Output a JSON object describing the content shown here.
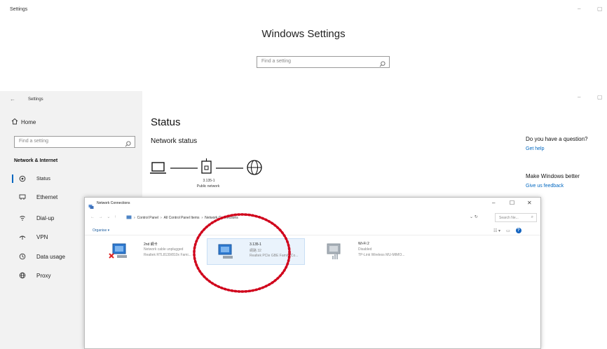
{
  "top_window": {
    "title": "Settings",
    "heading": "Windows Settings",
    "search_placeholder": "Find a setting"
  },
  "settings_window": {
    "title": "Settings",
    "home_label": "Home",
    "search_placeholder": "Find a setting",
    "section_label": "Network & Internet",
    "nav_items": [
      {
        "label": "Status",
        "icon": "status-icon",
        "active": true
      },
      {
        "label": "Ethernet",
        "icon": "ethernet-icon",
        "active": false
      },
      {
        "label": "Dial-up",
        "icon": "dialup-icon",
        "active": false
      },
      {
        "label": "VPN",
        "icon": "vpn-icon",
        "active": false
      },
      {
        "label": "Data usage",
        "icon": "data-usage-icon",
        "active": false
      },
      {
        "label": "Proxy",
        "icon": "proxy-icon",
        "active": false
      }
    ],
    "page_title": "Status",
    "network_status_heading": "Network status",
    "network_name": "3.135-1",
    "network_type": "Public network",
    "question_heading": "Do you have a question?",
    "get_help_link": "Get help",
    "feedback_heading": "Make Windows better",
    "feedback_link": "Give us feedback"
  },
  "network_connections": {
    "title": "Network Connections",
    "breadcrumb": [
      "Control Panel",
      "All Control Panel Items",
      "Network Connections"
    ],
    "search_placeholder": "Search Ne...",
    "organise_label": "Organise ▾",
    "adapters": [
      {
        "name": "2nd 網卡",
        "status": "Network cable unplugged",
        "device": "Realtek RTL8139/810x Fami...",
        "state": "disconnected"
      },
      {
        "name": "3.135-1",
        "status": "網路 32",
        "device": "Realtek PCIe GBE Family Co...",
        "state": "connected"
      },
      {
        "name": "Wi-Fi 2",
        "status": "Disabled",
        "device": "TP-Link Wireless MU-MIMO...",
        "state": "disabled"
      }
    ]
  },
  "colors": {
    "accent": "#0067c0",
    "annotation": "#d0021b",
    "sidebar_bg": "#f2f2f2"
  }
}
